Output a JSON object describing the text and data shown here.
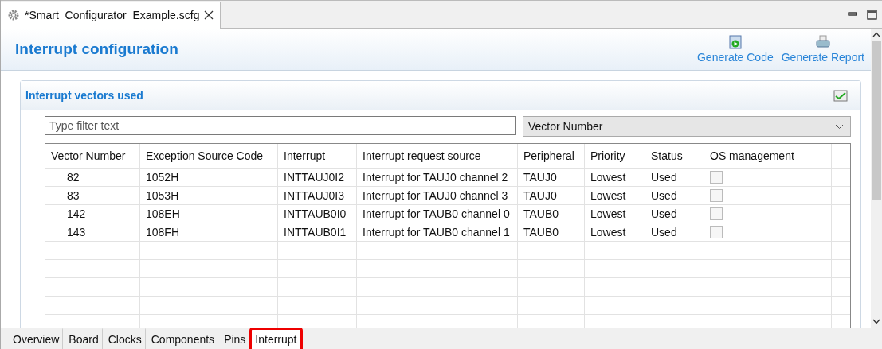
{
  "editor_tab": {
    "title": "*Smart_Configurator_Example.scfg"
  },
  "page": {
    "title": "Interrupt configuration",
    "actions": [
      {
        "kind": "code",
        "label": "Generate Code"
      },
      {
        "kind": "report",
        "label": "Generate Report"
      }
    ]
  },
  "section": {
    "title": "Interrupt vectors used",
    "filter": {
      "placeholder": "Type filter text"
    },
    "sort_by": {
      "value": "Vector Number"
    }
  },
  "table": {
    "columns": [
      "Vector Number",
      "Exception Source Code",
      "Interrupt",
      "Interrupt request source",
      "Peripheral",
      "Priority",
      "Status",
      "OS management"
    ],
    "rows": [
      {
        "vector": "82",
        "code": "1052H",
        "interrupt": "INTTAUJ0I2",
        "source": "Interrupt for TAUJ0 channel 2",
        "peripheral": "TAUJ0",
        "priority": "Lowest",
        "status": "Used",
        "os_managed": false
      },
      {
        "vector": "83",
        "code": "1053H",
        "interrupt": "INTTAUJ0I3",
        "source": "Interrupt for TAUJ0 channel 3",
        "peripheral": "TAUJ0",
        "priority": "Lowest",
        "status": "Used",
        "os_managed": false
      },
      {
        "vector": "142",
        "code": "108EH",
        "interrupt": "INTTAUB0I0",
        "source": "Interrupt for TAUB0 channel 0",
        "peripheral": "TAUB0",
        "priority": "Lowest",
        "status": "Used",
        "os_managed": false
      },
      {
        "vector": "143",
        "code": "108FH",
        "interrupt": "INTTAUB0I1",
        "source": "Interrupt for TAUB0 channel 1",
        "peripheral": "TAUB0",
        "priority": "Lowest",
        "status": "Used",
        "os_managed": false
      }
    ]
  },
  "bottom_tabs": [
    {
      "label": "Overview",
      "selected": false,
      "highlighted": false
    },
    {
      "label": "Board",
      "selected": false,
      "highlighted": false
    },
    {
      "label": "Clocks",
      "selected": false,
      "highlighted": false
    },
    {
      "label": "Components",
      "selected": false,
      "highlighted": false
    },
    {
      "label": "Pins",
      "selected": false,
      "highlighted": false
    },
    {
      "label": "Interrupt",
      "selected": true,
      "highlighted": true
    }
  ]
}
